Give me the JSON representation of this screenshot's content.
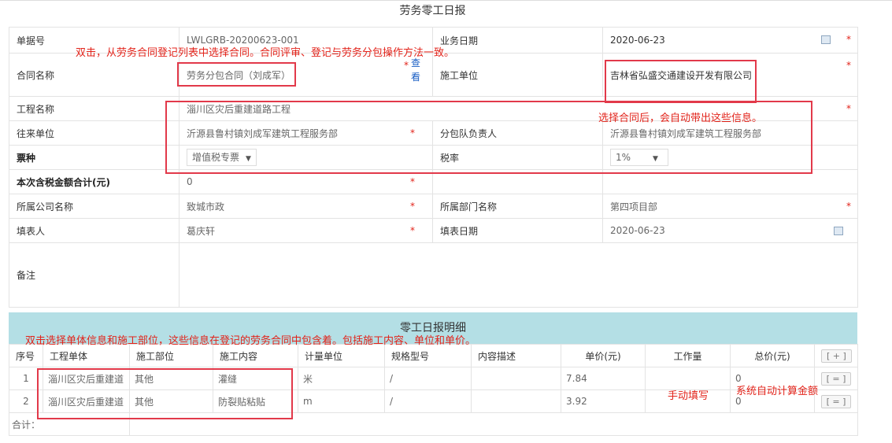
{
  "form": {
    "title": "劳务零工日报",
    "labels": {
      "doc_no": "单据号",
      "biz_date": "业务日期",
      "contract_name": "合同名称",
      "construction_unit": "施工单位",
      "project_name": "工程名称",
      "partner_unit": "往来单位",
      "subcontract_leader": "分包队负责人",
      "ticket_type": "票种",
      "tax_rate": "税率",
      "total_amount": "本次含税金额合计(元)",
      "company": "所属公司名称",
      "department": "所属部门名称",
      "filler": "填表人",
      "fill_date": "填表日期",
      "remark": "备注"
    },
    "values": {
      "doc_no": "LWLGRB-20200623-001",
      "biz_date": "2020-06-23",
      "contract_name": "劳务分包合同（刘成军）",
      "view_link": "查看",
      "construction_unit": "吉林省弘盛交通建设开发有限公司",
      "project_name": "淄川区灾后重建道路工程",
      "partner_unit": "沂源县鲁村镇刘成军建筑工程服务部",
      "subcontract_leader": "沂源县鲁村镇刘成军建筑工程服务部",
      "ticket_type": "增值税专票",
      "tax_rate": "1%",
      "total_amount": "0",
      "company": "致城市政",
      "department": "第四项目部",
      "filler": "葛庆轩",
      "fill_date": "2020-06-23",
      "remark": ""
    },
    "required_mark": "*"
  },
  "detail": {
    "title": "零工日报明细",
    "columns": [
      "序号",
      "工程单体",
      "施工部位",
      "施工内容",
      "计量单位",
      "规格型号",
      "内容描述",
      "单价(元)",
      "工作量",
      "总价(元)"
    ],
    "add_button": "[ + ]",
    "row_button": "[ = ]",
    "rows": [
      {
        "no": "1",
        "unit_project": "淄川区灾后重建道",
        "position": "其他",
        "content": "灌缝",
        "measure": "米",
        "spec": "/",
        "desc": "",
        "price": "7.84",
        "qty": "",
        "total": "0"
      },
      {
        "no": "2",
        "unit_project": "淄川区灾后重建道",
        "position": "其他",
        "content": "防裂贴粘贴",
        "measure": "m",
        "spec": "/",
        "desc": "",
        "price": "3.92",
        "qty": "",
        "total": "0"
      }
    ],
    "sum_label": "合计："
  },
  "annotations": {
    "contract_hint": "双击，从劳务合同登记列表中选择合同。合同评审、登记与劳务分包操作方法一致。",
    "auto_fill_hint": "选择合同后，会自动带出这些信息。",
    "detail_hint": "双击选择单体信息和施工部位，这些信息在登记的劳务合同中包含着。包括施工内容、单位和单价。",
    "manual_hint": "手动填写",
    "auto_calc_hint": "系统自动计算金额"
  },
  "colors": {
    "annotation": "#e2231a",
    "detail_header_bg": "#b4dfe5",
    "link": "#1b5fc4"
  }
}
